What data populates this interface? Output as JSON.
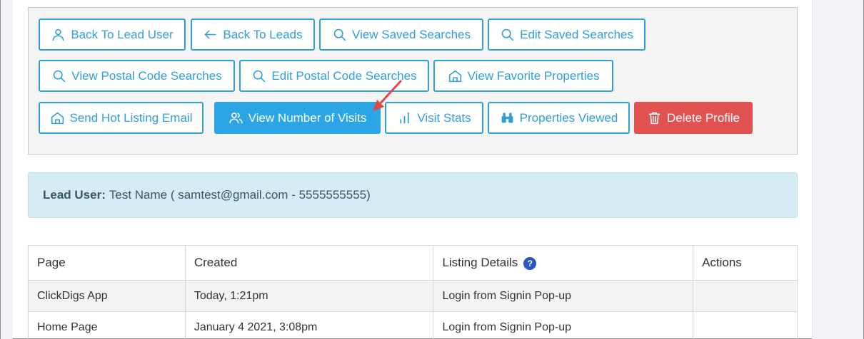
{
  "toolbar": {
    "buttons": [
      {
        "label": "Back To Lead User",
        "icon": "user-icon"
      },
      {
        "label": "Back To Leads",
        "icon": "arrow-left-icon"
      },
      {
        "label": "View Saved Searches",
        "icon": "search-icon"
      },
      {
        "label": "Edit Saved Searches",
        "icon": "search-icon"
      },
      {
        "label": "View Postal Code Searches",
        "icon": "search-icon"
      },
      {
        "label": "Edit Postal Code Searches",
        "icon": "search-icon"
      },
      {
        "label": "View Favorite Properties",
        "icon": "home-icon"
      },
      {
        "label": "Send Hot Listing Email",
        "icon": "home-icon"
      },
      {
        "label": "View Number of Visits",
        "icon": "users-icon"
      },
      {
        "label": "Visit Stats",
        "icon": "bar-chart-icon"
      },
      {
        "label": "Properties Viewed",
        "icon": "binoculars-icon"
      },
      {
        "label": "Delete Profile",
        "icon": "trash-icon"
      }
    ]
  },
  "lead": {
    "label": "Lead User:",
    "value": "Test Name ( samtest@gmail.com - 5555555555)"
  },
  "table": {
    "headers": [
      "Page",
      "Created",
      "Listing Details",
      "Actions"
    ],
    "help_icon": "?",
    "rows": [
      {
        "page": "ClickDigs App",
        "created": "Today, 1:21pm",
        "details": "Login from Signin Pop-up",
        "actions": ""
      },
      {
        "page": "Home Page",
        "created": "January 4 2021, 3:08pm",
        "details": "Login from Signin Pop-up",
        "actions": ""
      }
    ]
  },
  "colors": {
    "accent": "#2f9fd8",
    "primary_button": "#2ba5e6",
    "danger_button": "#e15150",
    "info_background": "#d6ecf4",
    "annotation_arrow": "#e04848"
  }
}
